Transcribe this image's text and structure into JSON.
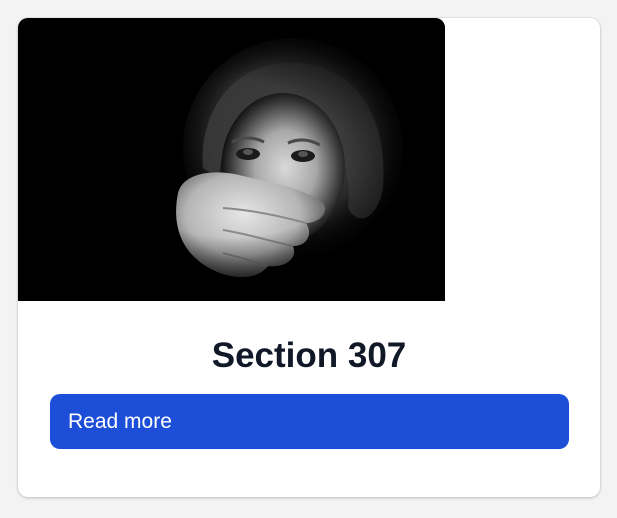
{
  "card": {
    "image_alt": "Black and white photo of a child with a hand covering her mouth",
    "title": "Section 307",
    "button_label": "Read more"
  },
  "colors": {
    "page_background": "#f3f3f3",
    "card_background": "#ffffff",
    "title_text": "#111827",
    "button_background": "#1d4ed8",
    "button_text": "#ffffff"
  }
}
